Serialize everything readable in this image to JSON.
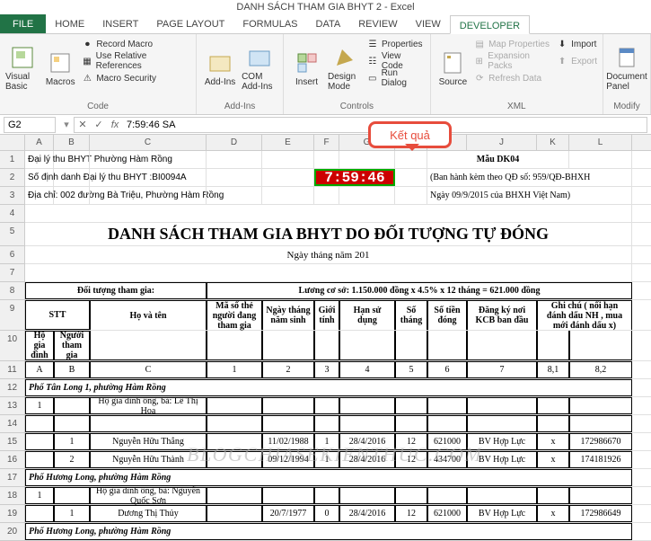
{
  "title": "DANH SÁCH THAM GIA BHYT 2 - Excel",
  "tabs": [
    "FILE",
    "HOME",
    "INSERT",
    "PAGE LAYOUT",
    "FORMULAS",
    "DATA",
    "REVIEW",
    "VIEW",
    "DEVELOPER"
  ],
  "ribbon": {
    "code": {
      "visual_basic": "Visual Basic",
      "macros": "Macros",
      "record": "Record Macro",
      "relative": "Use Relative References",
      "security": "Macro Security",
      "label": "Code"
    },
    "addins": {
      "addins": "Add-Ins",
      "com": "COM Add-Ins",
      "label": "Add-Ins"
    },
    "controls": {
      "insert": "Insert",
      "design": "Design Mode",
      "props": "Properties",
      "view_code": "View Code",
      "run": "Run Dialog",
      "label": "Controls"
    },
    "xml": {
      "source": "Source",
      "map": "Map Properties",
      "expand": "Expansion Packs",
      "refresh": "Refresh Data",
      "import": "Import",
      "export": "Export",
      "label": "XML"
    },
    "modify": {
      "doc": "Document Panel",
      "label": "Modify"
    }
  },
  "namebox": "G2",
  "formula": "7:59:46 SA",
  "callout": "Kết quả",
  "cols": [
    "A",
    "B",
    "C",
    "D",
    "E",
    "F",
    "G",
    "H",
    "I",
    "J",
    "K",
    "L"
  ],
  "r1": "Đại lý thu BHYT Phường Hàm Rồng",
  "r1j": "Mẫu DK04",
  "r2": "Số định danh Đại lý thu BHYT :BI0094A",
  "timer": "7:59:46",
  "r2i": "(Ban hành kèm theo QĐ số: 959/QĐ-BHXH",
  "r3": "Địa chỉ: 002 đường Bà Triệu, Phường Hàm Rồng",
  "r3i": "Ngày 09/9/2015 của BHXH Việt Nam)",
  "r5": "DANH SÁCH THAM GIA BHYT DO ĐỐI TƯỢNG TỰ ĐÓNG",
  "r6": "Ngày      tháng      năm 201",
  "r8a": "Đối tượng tham gia:",
  "r8f": "Lương cơ sở: 1.150.000 đồng x 4.5% x 12 tháng = 621.000 đồng",
  "hdr": {
    "stt": "STT",
    "ho_gd": "Hộ gia đình",
    "nguoi": "Người tham gia",
    "hoten": "Họ và tên",
    "maso": "Mã số thẻ người đang tham gia",
    "ngaysinh": "Ngày tháng năm sinh",
    "gioi": "Giới tính",
    "han": "Hạn sử dụng",
    "sothang": "Số tháng",
    "sotien": "Số tiền đóng",
    "dangky": "Đăng ký nơi KCB ban đầu",
    "ghichu": "Ghi chú ( nối hạn đánh dấu NH , mua mới đánh dấu x)"
  },
  "idx": {
    "a": "A",
    "b": "B",
    "c": "C",
    "d": "1",
    "e": "2",
    "f": "3",
    "g": "4",
    "h": "5",
    "i": "6",
    "j": "7",
    "k": "8,1",
    "l": "8,2"
  },
  "sec1": "Phố Tân Long 1, phường Hàm Rồng",
  "r13_row": {
    "a": "1",
    "c": "Hộ gia đình ông, bà: Lê Thị Hoa"
  },
  "r15": {
    "b": "1",
    "c": "Nguyễn Hữu Thắng",
    "e": "11/02/1988",
    "f": "1",
    "g": "28/4/2016",
    "h": "12",
    "i": "621000",
    "j": "BV Hợp Lực",
    "k": "x",
    "l": "172986670"
  },
  "r16": {
    "b": "2",
    "c": "Nguyễn Hữu Thành",
    "e": "09/12/1994",
    "f": "1",
    "g": "28/4/2016",
    "h": "12",
    "i": "434700",
    "j": "BV Hợp Lực",
    "k": "x",
    "l": "174181926"
  },
  "sec2": "Phố Hương Long, phường Hàm Rồng",
  "r18_row": {
    "a": "1",
    "c": "Hộ gia đình ông, bà: Nguyễn Quốc Sơn"
  },
  "r19": {
    "b": "1",
    "c": "Dương Thị Thủy",
    "e": "20/7/1977",
    "f": "0",
    "g": "28/4/2016",
    "h": "12",
    "i": "621000",
    "j": "BV Hợp Lực",
    "k": "x",
    "l": "172986649"
  },
  "sec3": "Phố Hương Long, phường Hàm Rồng",
  "watermark": "BLOGCHIASEKIENTHUC.COM"
}
